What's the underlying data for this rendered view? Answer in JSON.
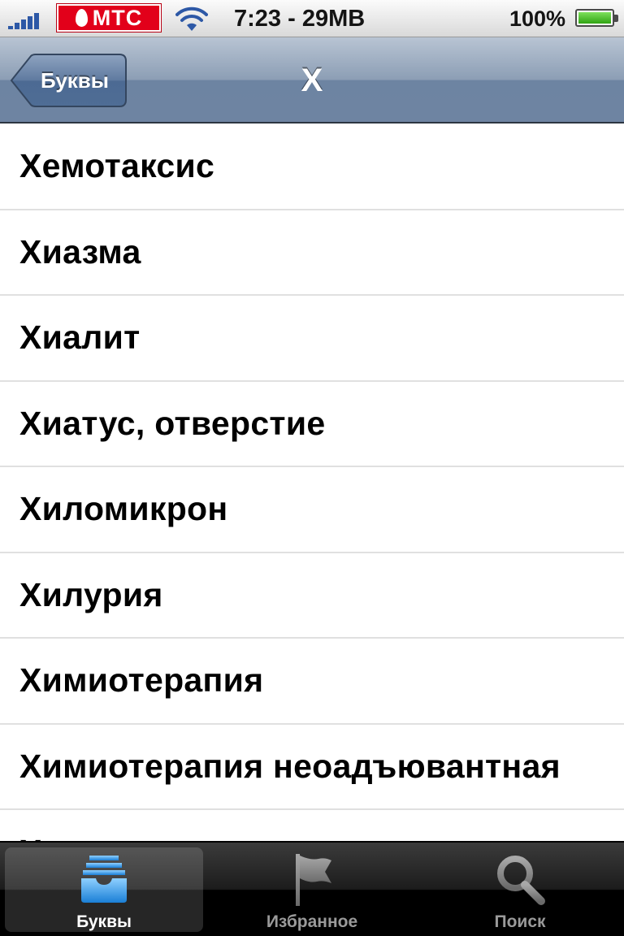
{
  "status_bar": {
    "carrier": "МТС",
    "time": "7:23 - 29MB",
    "battery_percent": "100%",
    "battery_level": 1.0,
    "signal_bars": 5,
    "icons": [
      "signal-icon",
      "wifi-icon",
      "battery-icon"
    ]
  },
  "nav": {
    "back_label": "Буквы",
    "title": "Х"
  },
  "list": {
    "items": [
      "Хемотаксис",
      "Хиазма",
      "Хиалит",
      "Хиатус, отверстие",
      "Хиломикрон",
      "Хилурия",
      "Химиотерапия",
      "Химиотерапия неоадъювантная",
      "Х"
    ]
  },
  "tab_bar": {
    "tabs": [
      {
        "label": "Буквы",
        "icon": "inbox-tray-icon",
        "selected": true
      },
      {
        "label": "Избранное",
        "icon": "flag-icon",
        "selected": false
      },
      {
        "label": "Поиск",
        "icon": "search-icon",
        "selected": false
      }
    ]
  },
  "colors": {
    "carrier_red": "#e2001a",
    "nav_blue": "#6d84a2",
    "selected_tab_icon": "#3aa0e8"
  }
}
